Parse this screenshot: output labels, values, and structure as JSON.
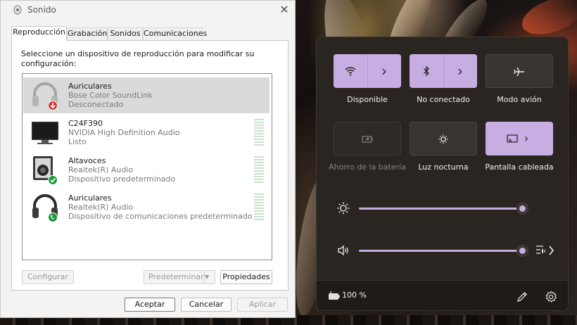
{
  "sound_dialog": {
    "title": "Sonido",
    "close_glyph": "✕",
    "tabs": [
      "Reproducción",
      "Grabación",
      "Sonidos",
      "Comunicaciones"
    ],
    "instructions": "Seleccione un dispositivo de reproducción para modificar su configuración:",
    "devices": [
      {
        "name": "Auriculares",
        "description": "Bose Color SoundLink",
        "status": "Desconectado",
        "icon": "headphones-disconnected-icon",
        "selected": true
      },
      {
        "name": "C24F390",
        "description": "NVIDIA High Definition Audio",
        "status": "Listo",
        "icon": "monitor-icon"
      },
      {
        "name": "Altavoces",
        "description": "Realtek(R) Audio",
        "status": "Dispositivo predeterminado",
        "icon": "speaker-default-icon"
      },
      {
        "name": "Auriculares",
        "description": "Realtek(R) Audio",
        "status": "Dispositivo de comunicaciones predeterminado",
        "icon": "headset-communications-icon"
      }
    ],
    "buttons": {
      "configure": "Configurar",
      "set_default": "Predeterminar",
      "properties": "Propiedades",
      "accept": "Aceptar",
      "cancel": "Cancelar",
      "apply": "Aplicar"
    }
  },
  "quick_settings": {
    "tiles": [
      {
        "label": "Disponible",
        "icon": "wifi-icon",
        "state": "on",
        "has_arrow": true
      },
      {
        "label": "No conectado",
        "icon": "bluetooth-icon",
        "state": "on",
        "has_arrow": true
      },
      {
        "label": "Modo avión",
        "icon": "airplane-icon",
        "state": "off"
      },
      {
        "label": "Ahorro de la batería",
        "icon": "battery-saver-icon",
        "state": "disabled"
      },
      {
        "label": "Luz nocturna",
        "icon": "night-light-icon",
        "state": "off"
      },
      {
        "label": "Pantalla cableada",
        "icon": "cast-icon",
        "state": "on",
        "has_arrow": true
      }
    ],
    "tile_arrow_glyph": "›",
    "brightness_level": 1.0,
    "volume_level": 1.0,
    "battery_text": "100 %",
    "colors": {
      "accent": "#c7aee2",
      "panel": "#2b2522",
      "footer": "#1f1b19"
    }
  }
}
